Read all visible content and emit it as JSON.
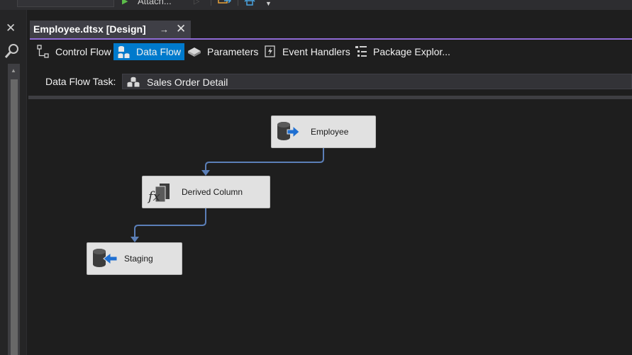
{
  "toolbar": {
    "attach_label": "Attach..."
  },
  "document_tab": {
    "title": "Employee.dtsx [Design]"
  },
  "designer_tabs": [
    {
      "label": "Control Flow",
      "active": false,
      "icon": "control-flow-icon"
    },
    {
      "label": "Data Flow",
      "active": true,
      "icon": "data-flow-icon"
    },
    {
      "label": "Parameters",
      "active": false,
      "icon": "parameters-icon"
    },
    {
      "label": "Event Handlers",
      "active": false,
      "icon": "event-handlers-icon"
    },
    {
      "label": "Package Explor...",
      "active": false,
      "icon": "package-explorer-icon"
    }
  ],
  "task_selector": {
    "label": "Data Flow Task:",
    "value": "Sales Order Detail"
  },
  "components": [
    {
      "name": "Employee",
      "icon": "ole-db-source-icon"
    },
    {
      "name": "Derived Column",
      "icon": "derived-column-icon"
    },
    {
      "name": "Staging",
      "icon": "ole-db-destination-icon"
    }
  ],
  "colors": {
    "accent": "#007acc",
    "tab_accent": "#8f6bd6",
    "path_arrow": "#5b7fb8",
    "component_bg": "#e1e1e1"
  }
}
